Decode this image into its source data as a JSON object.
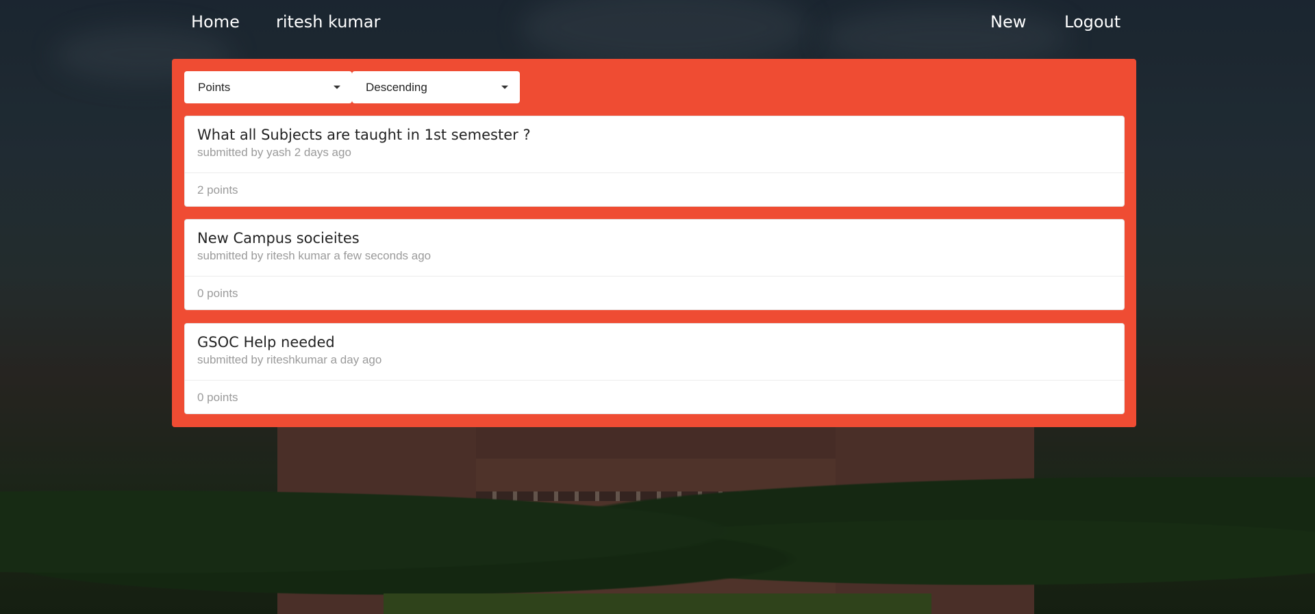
{
  "nav": {
    "home": "Home",
    "user": "ritesh kumar",
    "new": "New",
    "logout": "Logout"
  },
  "filters": {
    "sort_by": "Points",
    "order": "Descending"
  },
  "posts": [
    {
      "title": "What all Subjects are taught in 1st semester ?",
      "meta": "submitted by yash 2 days ago",
      "points": "2 points"
    },
    {
      "title": "New Campus socieites",
      "meta": "submitted by ritesh kumar a few seconds ago",
      "points": "0 points"
    },
    {
      "title": "GSOC Help needed",
      "meta": "submitted by riteshkumar a day ago",
      "points": "0 points"
    }
  ],
  "colors": {
    "panel": "#ef4c33",
    "card": "#ffffff",
    "meta_text": "#9a9a9a"
  }
}
